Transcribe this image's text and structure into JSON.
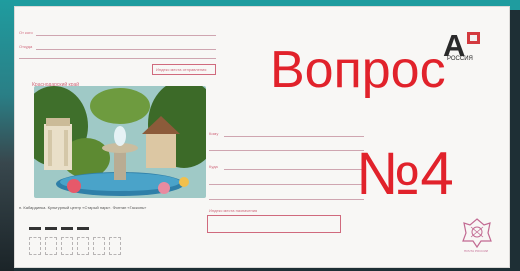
{
  "title": "Вопрос",
  "subtitle": "№4",
  "envelope": {
    "sender_from": "От кого",
    "sender_where": "Откуда",
    "region": "Краснодарский край",
    "index_label_top": "Индекс места отправления",
    "recipient_to": "Кому",
    "recipient_where": "Куда",
    "index_label_bottom": "Индекс места назначения",
    "caption": "п. Кабардинка. Культурный центр «Старый парк». Фонтан «Гасконь»",
    "stamp_letter": "А",
    "stamp_sub": "РОССИЯ",
    "emblem_caption": "ПОЧТА РОССИИ"
  },
  "colors": {
    "title": "#e1222b",
    "envelope_print": "#d06a7d",
    "background_accent": "#1f9c9f"
  }
}
